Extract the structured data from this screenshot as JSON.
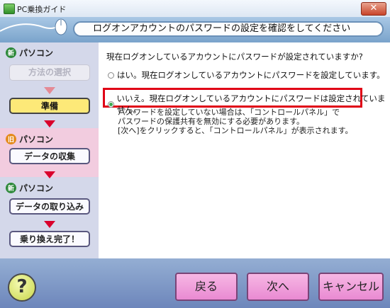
{
  "window": {
    "title": "PC乗換ガイド",
    "close_symbol": "✕"
  },
  "header": {
    "title": "ログオンアカウントのパスワードの設定を確認をしてください"
  },
  "sidebar": {
    "sections": [
      {
        "badge": "新",
        "label": "パソコン"
      },
      {
        "badge": "旧",
        "label": "パソコン"
      },
      {
        "badge": "新",
        "label": "パソコン"
      }
    ],
    "steps": [
      {
        "label": "方法の選択",
        "state": "inactive"
      },
      {
        "label": "準備",
        "state": "active"
      },
      {
        "label": "データの収集",
        "state": "normal"
      },
      {
        "label": "データの取り込み",
        "state": "normal"
      },
      {
        "label": "乗り換え完了！",
        "state": "normal"
      }
    ]
  },
  "main": {
    "question": "現在ログオンしているアカウントにパスワードが設定されていますか?",
    "option_yes": "はい。現在ログオンしているアカウントにパスワードを設定しています。",
    "option_no": "いいえ。現在ログオンしているアカウントにパスワードは設定されていません。",
    "selected": "no",
    "note_lines": [
      "パスワードを設定していない場合は、「コントロールパネル」で",
      "パスワードの保護共有を無効にする必要があります。",
      "[次へ]をクリックすると、「コントロールパネル」が表示されます。"
    ]
  },
  "footer": {
    "help": "?",
    "back": "戻る",
    "next": "次へ",
    "cancel": "キャンセル"
  },
  "colors": {
    "highlight": "#e00016",
    "arrow": "#d9002c",
    "active_step": "#fde978",
    "nav_button": "#e98ad2"
  }
}
